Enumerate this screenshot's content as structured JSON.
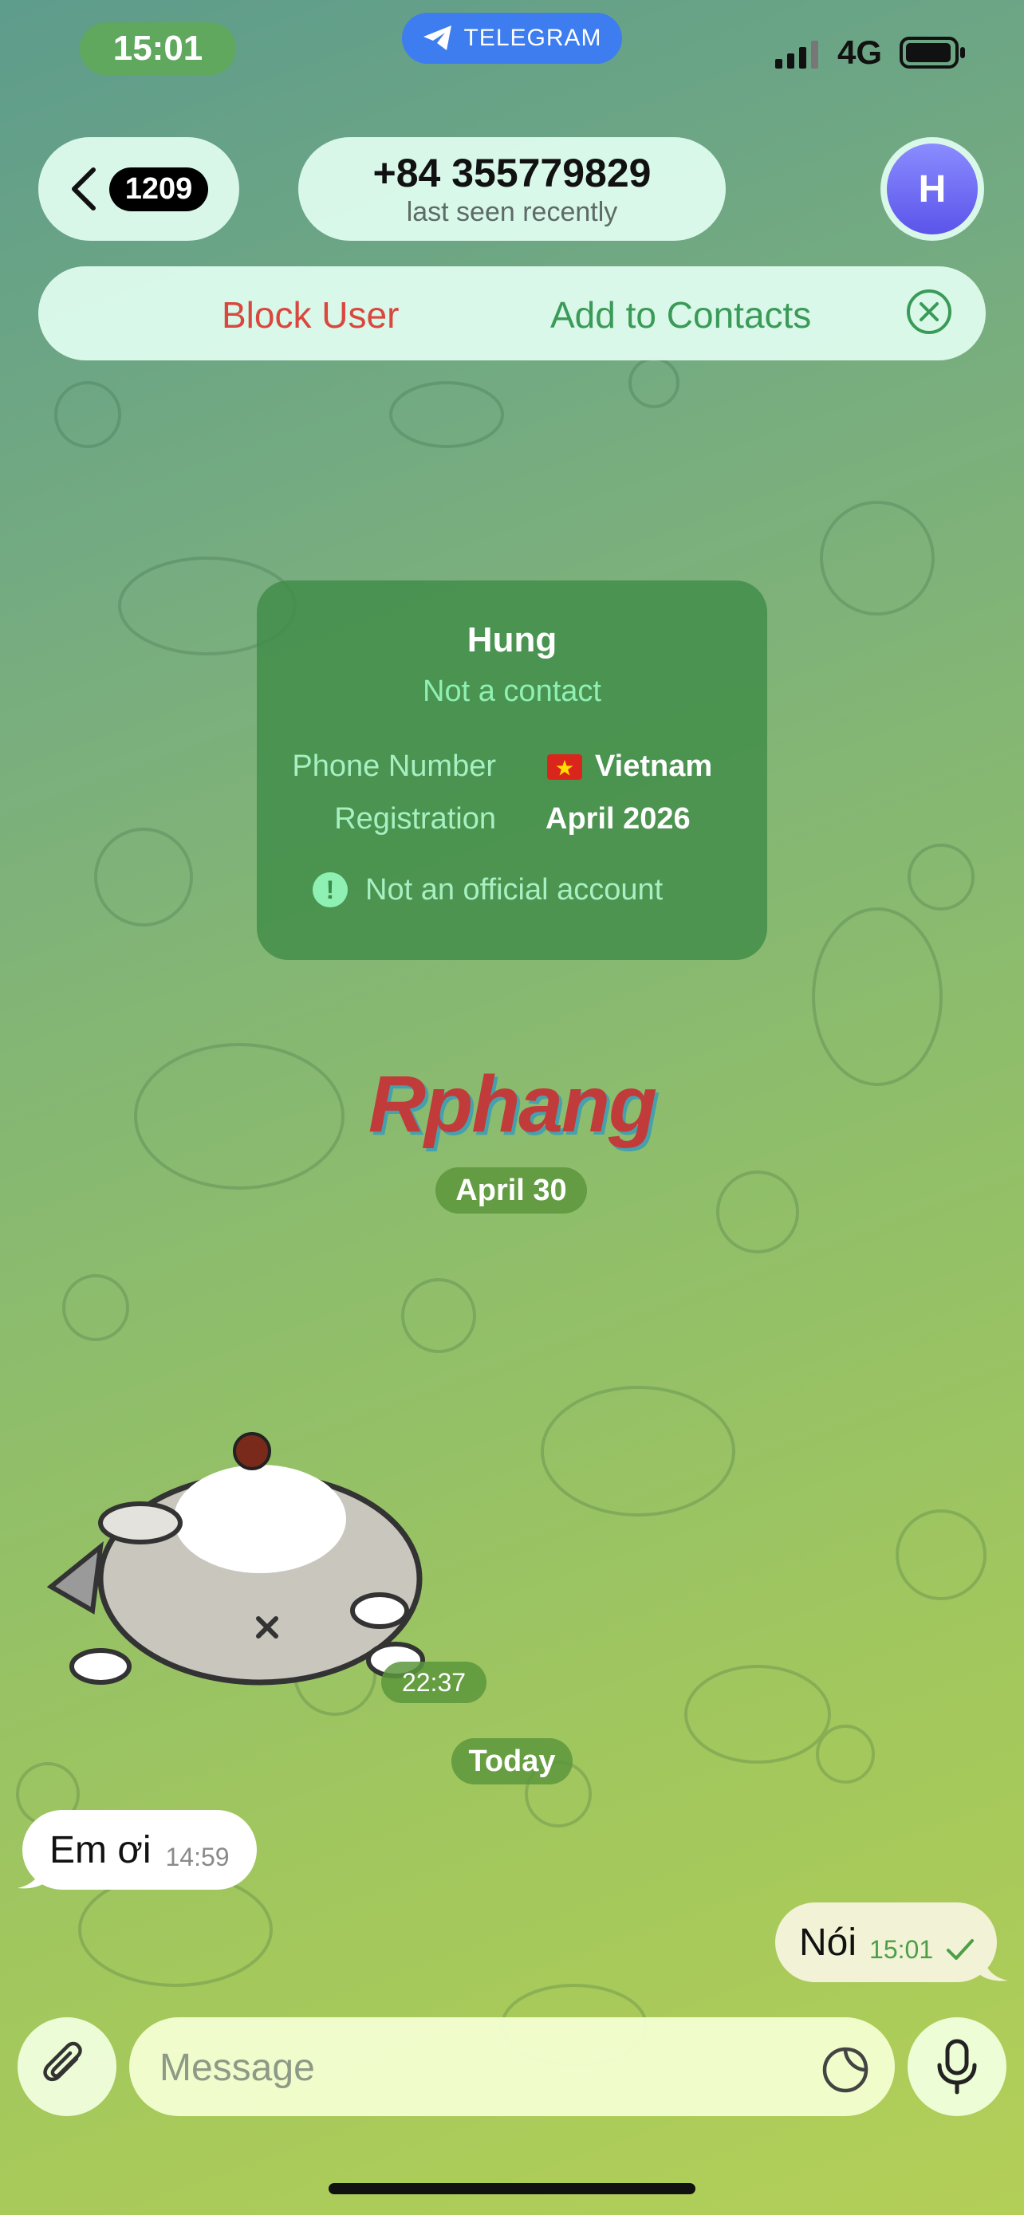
{
  "status_bar": {
    "time": "15:01",
    "app_pill": "TELEGRAM",
    "network": "4G"
  },
  "header": {
    "back_count": "1209",
    "phone": "+84 355779829",
    "last_seen": "last seen recently",
    "avatar_initial": "H"
  },
  "action_bar": {
    "block_label": "Block User",
    "add_label": "Add to Contacts"
  },
  "info_card": {
    "name": "Hung",
    "status": "Not a contact",
    "phone_label": "Phone Number",
    "phone_value": "Vietnam",
    "registration_label": "Registration",
    "registration_value": "April 2026",
    "warning": "Not an official account"
  },
  "watermark": "Rphang",
  "messages": {
    "date_1": "April 30",
    "sticker_time": "22:37",
    "date_2": "Today",
    "incoming": {
      "text": "Em ơi",
      "time": "14:59"
    },
    "outgoing": {
      "text": "Nói",
      "time": "15:01"
    }
  },
  "composer": {
    "placeholder": "Message"
  },
  "colors": {
    "block": "#d9473e",
    "add": "#3a9a57",
    "accent": "#3d7df0"
  },
  "icons": [
    "telegram-icon",
    "signal-icon",
    "battery-icon",
    "chevron-left-icon",
    "close-circle-icon",
    "vietnam-flag-icon",
    "warning-icon",
    "check-icon",
    "paperclip-icon",
    "sticker-icon",
    "microphone-icon"
  ]
}
